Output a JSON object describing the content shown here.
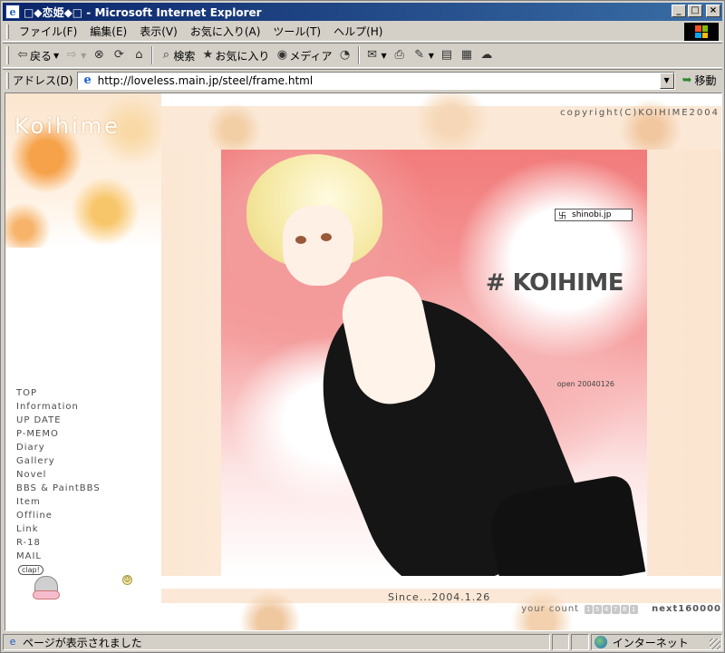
{
  "window": {
    "title": "□◆恋姫◆□ - Microsoft Internet Explorer",
    "minimize": "_",
    "maximize": "□",
    "close": "×"
  },
  "menu": [
    "ファイル(F)",
    "編集(E)",
    "表示(V)",
    "お気に入り(A)",
    "ツール(T)",
    "ヘルプ(H)"
  ],
  "toolbar": {
    "back": "戻る",
    "search": "検索",
    "favorites": "お気に入り",
    "media": "メディア"
  },
  "address": {
    "label": "アドレス(D)",
    "url": "http://loveless.main.jp/steel/frame.html",
    "go": "移動"
  },
  "site": {
    "logo": "Koihime",
    "copyright": "copyright(C)KOIHIME2004",
    "title": "# KOIHIME",
    "open": "open 20040126",
    "shinobi": "shinobi.jp",
    "since": "Since...2004.1.26",
    "counter_label": "your count",
    "counter_digits": [
      "1",
      "5",
      "4",
      "7",
      "8",
      "1"
    ],
    "next": "next160000",
    "clap": "clap!",
    "nav": [
      "TOP",
      "Information",
      "UP DATE",
      "P-MEMO",
      "Diary",
      "Gallery",
      "Novel",
      "BBS & PaintBBS",
      "Item",
      "Offline",
      "Link",
      "R-18",
      "MAIL"
    ]
  },
  "status": {
    "text": "ページが表示されました",
    "zone": "インターネット"
  }
}
